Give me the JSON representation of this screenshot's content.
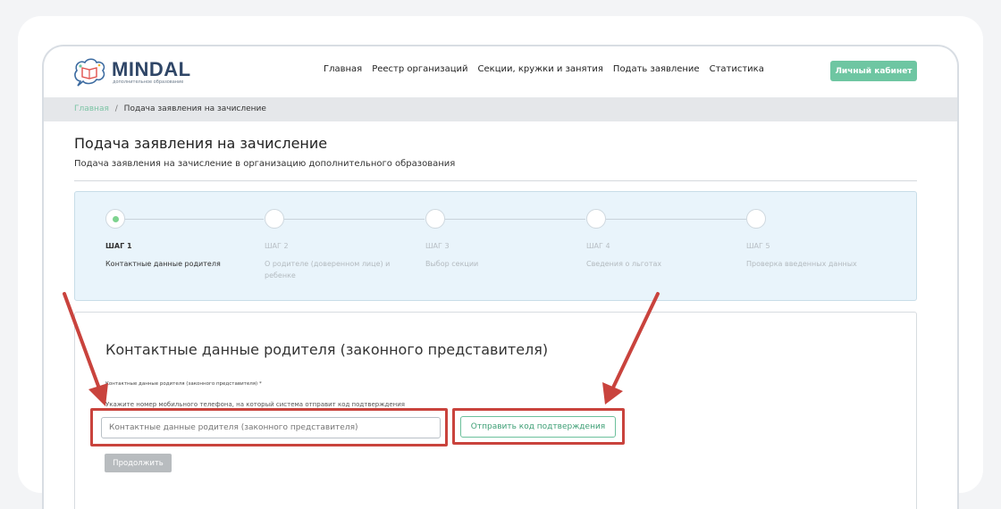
{
  "brand": {
    "name": "MINDAL",
    "subtitle": "дополнительное образование"
  },
  "nav": {
    "items": [
      "Главная",
      "Реестр организаций",
      "Секции, кружки и занятия",
      "Подать заявление",
      "Статистика"
    ],
    "cabinet_label": "Личный кабинет"
  },
  "breadcrumb": {
    "home": "Главная",
    "separator": "/",
    "current": "Подача заявления на зачисление"
  },
  "page": {
    "title": "Подача заявления на зачисление",
    "subtitle": "Подача заявления на зачисление в организацию дополнительного образования"
  },
  "steps": [
    {
      "label": "ШАГ 1",
      "desc": "Контактные данные родителя",
      "active": true
    },
    {
      "label": "ШАГ 2",
      "desc": "О родителе (доверенном лице) и ребенке",
      "active": false
    },
    {
      "label": "ШАГ 3",
      "desc": "Выбор секции",
      "active": false
    },
    {
      "label": "ШАГ 4",
      "desc": "Сведения о льготах",
      "active": false
    },
    {
      "label": "ШАГ 5",
      "desc": "Проверка введенных данных",
      "active": false
    }
  ],
  "form": {
    "title": "Контактные данные родителя (законного представителя)",
    "field_label": "Контактные данные родителя (законного представителя) *",
    "hint": "Укажите номер мобильного телефона, на который система отправит код подтверждения",
    "input_placeholder": "Контактные данные родителя (законного представителя)",
    "send_code_label": "Отправить код подтверждения",
    "continue_label": "Продолжить"
  },
  "colors": {
    "accent": "#6ec6a2",
    "annotation": "#c9433d",
    "stepper_bg": "#e9f4fb"
  }
}
